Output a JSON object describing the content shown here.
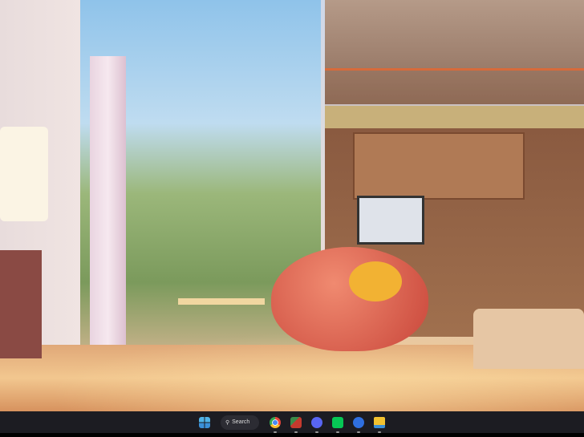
{
  "taskbar": {
    "search_label": "Search",
    "apps": [
      {
        "name": "start",
        "icon": "windows-start-icon",
        "color": "#4fb3e8"
      },
      {
        "name": "chrome",
        "icon": "chrome-icon",
        "color": "#e8453c"
      },
      {
        "name": "app-red",
        "icon": "app-icon",
        "color": "#c53a2e"
      },
      {
        "name": "discord",
        "icon": "discord-icon",
        "color": "#5865f2"
      },
      {
        "name": "line",
        "icon": "line-icon",
        "color": "#06c755"
      },
      {
        "name": "app-blue",
        "icon": "blue-app-icon",
        "color": "#2f6fe0"
      },
      {
        "name": "file-explorer",
        "icon": "folder-icon",
        "color": "#f2c230"
      }
    ]
  }
}
